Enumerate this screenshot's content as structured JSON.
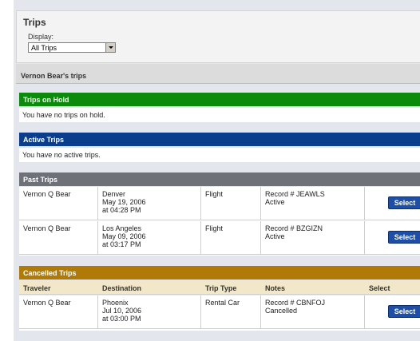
{
  "header": {
    "title": "Trips",
    "display_label": "Display:",
    "display_value": "All Trips"
  },
  "owner": "Vernon Bear's trips",
  "sections": {
    "on_hold": {
      "title": "Trips on Hold",
      "message": "You have no trips on hold.",
      "color": "#0b8a0b"
    },
    "active": {
      "title": "Active Trips",
      "message": "You have no active trips.",
      "color": "#0a3d8c"
    },
    "past": {
      "title": "Past Trips",
      "color": "#6e7178",
      "rows": [
        {
          "traveler": "Vernon Q Bear",
          "destination": "Denver\nMay 19, 2006\nat 04:28 PM",
          "type": "Flight",
          "notes": "Record # JEAWLS\nActive",
          "action": "Select"
        },
        {
          "traveler": "Vernon Q Bear",
          "destination": "Los Angeles\nMay 09, 2006\nat 03:17 PM",
          "type": "Flight",
          "notes": "Record # BZGIZN\nActive",
          "action": "Select"
        }
      ]
    },
    "cancelled": {
      "title": "Cancelled Trips",
      "color": "#b07a06",
      "columns": [
        "Traveler",
        "Destination",
        "Trip Type",
        "Notes",
        "Select"
      ],
      "rows": [
        {
          "traveler": "Vernon Q Bear",
          "destination": "Phoenix\nJul 10, 2006\nat 03:00 PM",
          "type": "Rental Car",
          "notes": "Record # CBNFOJ\nCancelled",
          "action": "Select"
        }
      ]
    }
  }
}
